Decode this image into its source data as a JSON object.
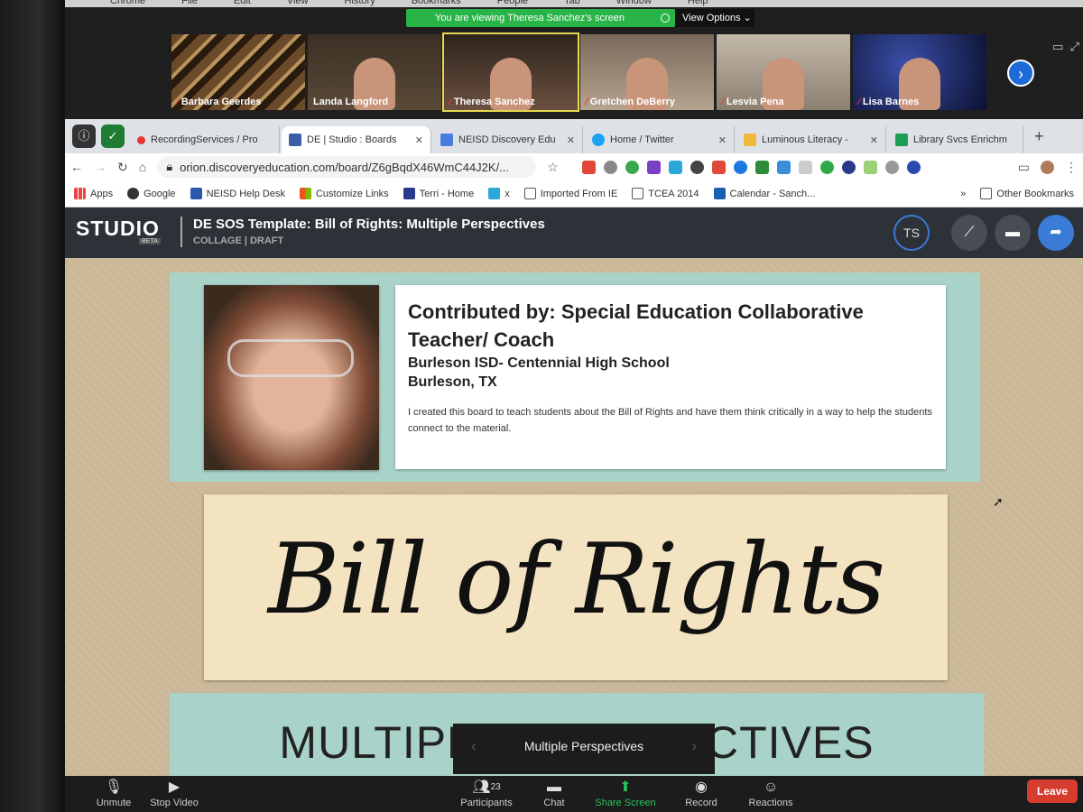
{
  "mac_menu": [
    "Chrome",
    "File",
    "Edit",
    "View",
    "History",
    "Bookmarks",
    "People",
    "Tab",
    "Window",
    "Help"
  ],
  "zoom": {
    "viewing_banner": "You are viewing Theresa Sanchez's screen",
    "view_options": "View Options",
    "participants": [
      "Barbara Geerdes",
      "Landa Langford",
      "Theresa Sanchez",
      "Gretchen DeBerry",
      "Lesvia Pena",
      "Lisa Barnes"
    ],
    "bottom": {
      "unmute": "Unmute",
      "stop_video": "Stop Video",
      "participants": "Participants",
      "participants_count": "23",
      "chat": "Chat",
      "share_screen": "Share Screen",
      "record": "Record",
      "reactions": "Reactions",
      "leave": "Leave"
    }
  },
  "browser": {
    "tabs": [
      {
        "label": "RecordingServices / Pro"
      },
      {
        "label": "DE | Studio : Boards"
      },
      {
        "label": "NEISD Discovery Edu"
      },
      {
        "label": "Home / Twitter"
      },
      {
        "label": "Luminous Literacy -"
      },
      {
        "label": "Library Svcs Enrichm"
      }
    ],
    "url": "orion.discoveryeducation.com/board/Z6gBqdX46WmC44J2K/...",
    "bookmarks": [
      "Apps",
      "Google",
      "NEISD Help Desk",
      "Customize Links",
      "Terri - Home",
      "x",
      "Imported From IE",
      "TCEA 2014",
      "Calendar - Sanch..."
    ],
    "other_bookmarks": "Other Bookmarks"
  },
  "studio": {
    "logo": "STUDIO",
    "beta": "BETA",
    "title": "DE SOS Template: Bill of Rights: Multiple Perspectives",
    "subtitle": "COLLAGE | DRAFT",
    "user_initials": "TS"
  },
  "board": {
    "contrib_heading": "Contributed by: Special Education Collaborative Teacher/ Coach",
    "school": "Burleson ISD- Centennial High School",
    "location": "Burleson, TX",
    "description": "I created this board to teach students about the Bill of Rights and have them think critically in a way to help the students connect to the material.",
    "banner_text": "Bill of Rights",
    "section_heading": "MULTIPLE PERSPECTIVES",
    "tooltip": "Multiple Perspectives"
  }
}
